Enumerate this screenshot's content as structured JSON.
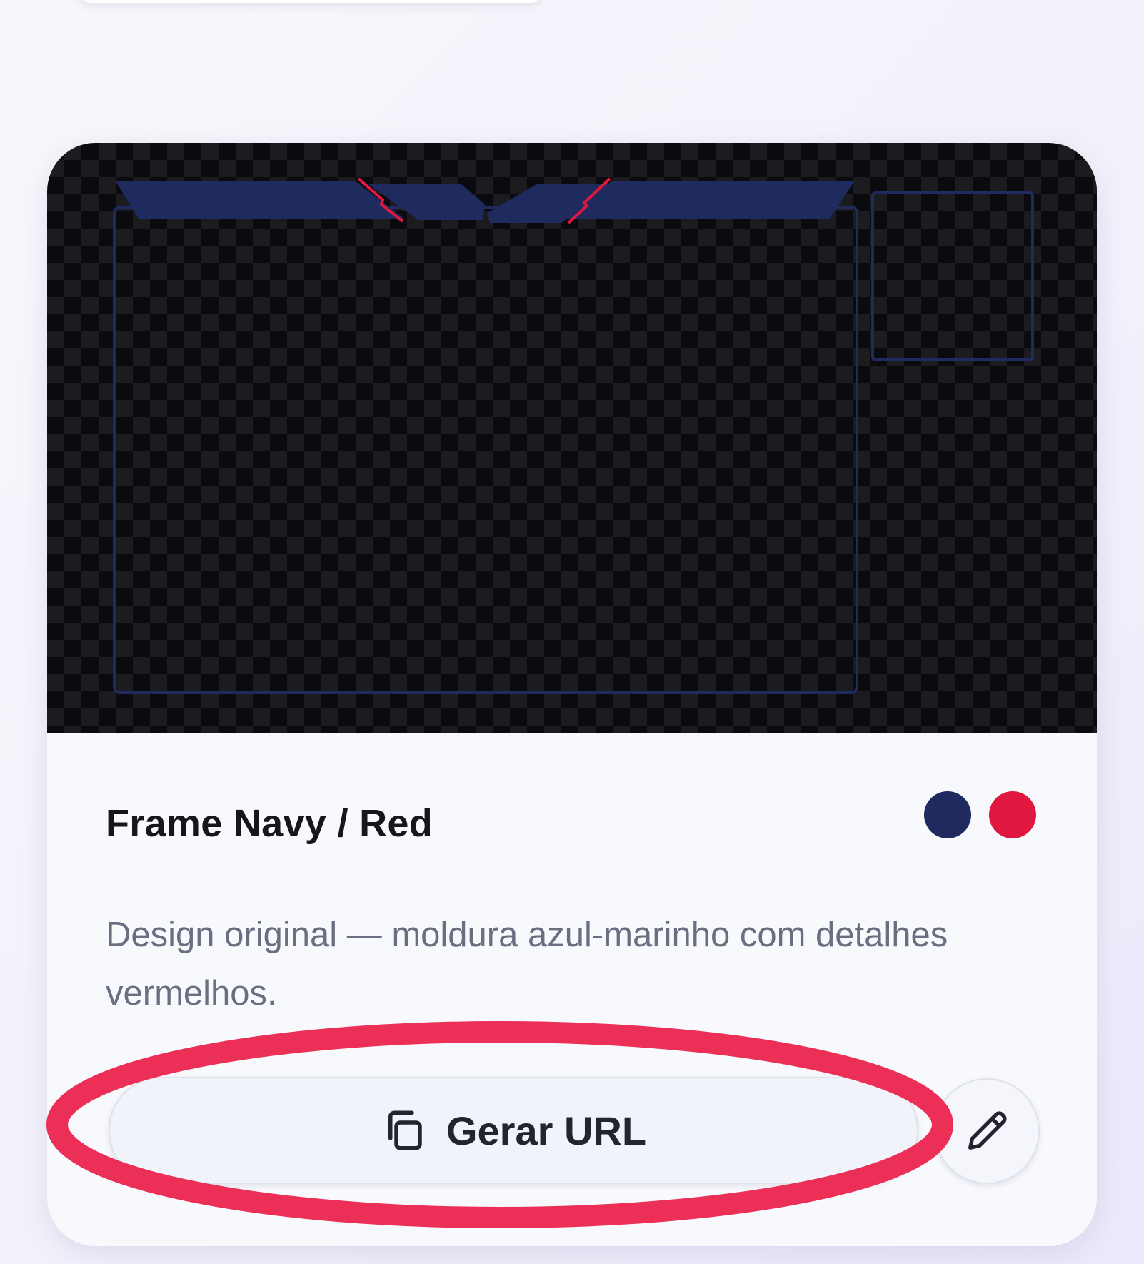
{
  "card": {
    "title": "Frame Navy / Red",
    "description": "Design original — moldura azul-marinho com detalhes vermelhos.",
    "colors": {
      "primary": "#1f2a5e",
      "accent": "#e0173f"
    },
    "actions": {
      "generate_label": "Gerar URL",
      "generate_icon": "copy-icon",
      "edit_icon": "pencil-icon"
    }
  },
  "annotation": {
    "color": "#ec2f56"
  }
}
